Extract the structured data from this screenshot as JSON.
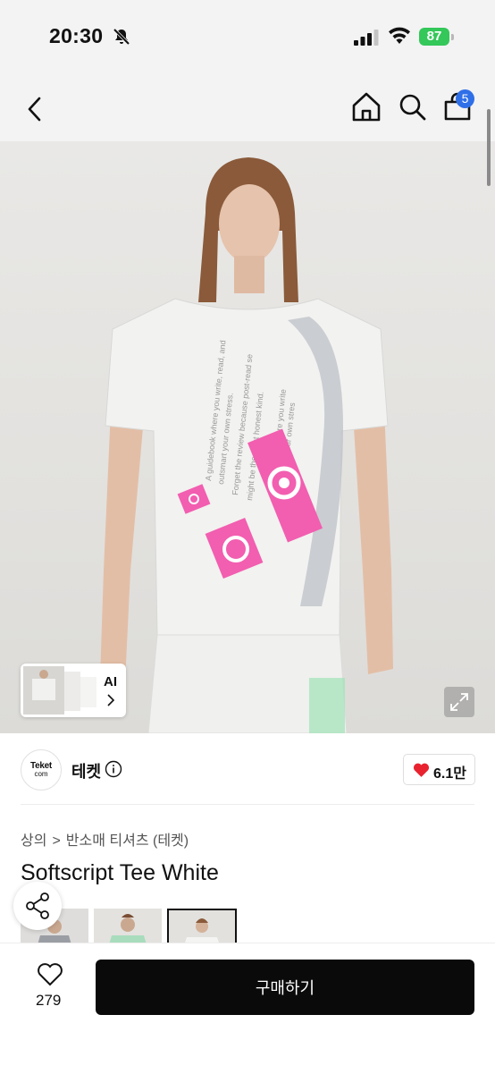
{
  "status_bar": {
    "time": "20:30",
    "battery": "87",
    "icons": [
      "bell-slash-icon",
      "signal-icon",
      "wifi-icon",
      "battery-charging-icon"
    ]
  },
  "nav": {
    "icons": [
      "chevron-left-icon",
      "home-icon",
      "search-icon",
      "bag-icon"
    ],
    "cart_badge": "5"
  },
  "hero": {
    "ai_label": "AI",
    "expand_icon": "expand-icon"
  },
  "brand": {
    "logo_line1": "Teket",
    "logo_line2": "com",
    "name": "테켓",
    "likes": "6.1만"
  },
  "breadcrumb": {
    "level1": "상의",
    "separator": ">",
    "level2": "반소매 티셔츠 (테켓)"
  },
  "product": {
    "title": "Softscript Tee White"
  },
  "bottom": {
    "wish_count": "279",
    "buy_label": "구매하기"
  },
  "colors": {
    "accent_blue": "#2f6fe8",
    "heart_red": "#e8232f",
    "battery_green": "#34c759",
    "buy_button": "#0a0a0a"
  }
}
